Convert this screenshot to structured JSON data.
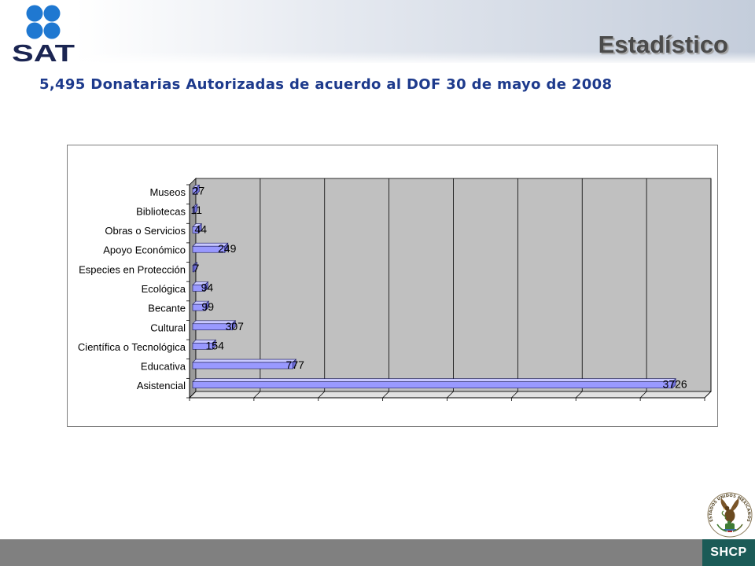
{
  "header": {
    "logo_text": "SAT",
    "title": "Estadístico"
  },
  "subtitle": "5,495 Donatarias Autorizadas de acuerdo al DOF 30 de mayo de 2008",
  "footer": {
    "agency_text": "SHCP",
    "seal_text": "ESTADOS UNIDOS MEXICANOS"
  },
  "icons": {
    "logo": "sat-four-dots-logo",
    "seal": "mexican-coat-of-arms"
  },
  "colors": {
    "logo_dots": "#1f78d1",
    "logo_text": "#1b2552",
    "title": "#4b4b4b",
    "subtitle": "#1d3a8c",
    "bar": "#9999ff",
    "plot_wall": "#c0c0c0",
    "footer_bar": "#808080",
    "shcp_box": "#1b5b57"
  },
  "chart_data": {
    "type": "bar",
    "orientation": "horizontal",
    "three_d": true,
    "title": "",
    "categories": [
      "Museos",
      "Bibliotecas",
      "Obras o Servicios",
      "Apoyo Económico",
      "Especies en Protección",
      "Ecológica",
      "Becante",
      "Cultural",
      "Científica o Tecnológica",
      "Educativa",
      "Asistencial"
    ],
    "values": [
      27,
      11,
      44,
      249,
      7,
      94,
      99,
      307,
      154,
      777,
      3726
    ],
    "xlim": [
      0,
      4000
    ],
    "x_major_unit": 500,
    "x_tick_labels": false,
    "grid": true,
    "legend": "none",
    "data_labels": true
  }
}
